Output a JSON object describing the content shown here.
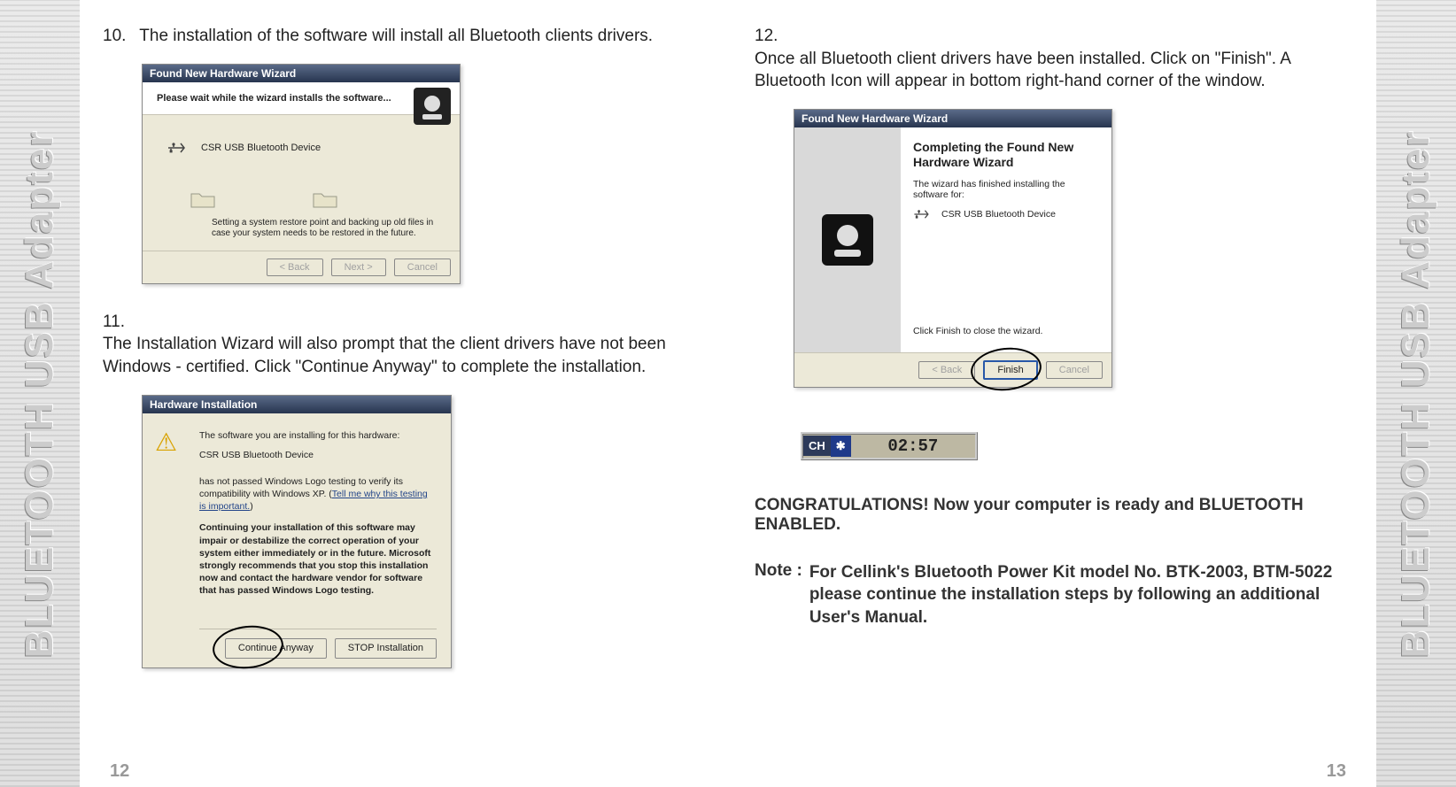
{
  "side_label": "BLUETOOTH USB Adapter",
  "left_page": {
    "number": "12",
    "step10": {
      "num": "10.",
      "text": "The installation of the software will install  all Bluetooth clients drivers."
    },
    "step11": {
      "num": "11.",
      "text": "The Installation Wizard will also prompt that  the client drivers have not been Windows - certified. Click \"Continue Anyway\" to complete the installation."
    },
    "installing_dialog": {
      "title": "Found New Hardware Wizard",
      "heading": "Please wait while the wizard installs the software...",
      "device": "CSR USB Bluetooth Device",
      "subtext": "Setting a system restore point and backing up old files in case your system needs to be restored in the future.",
      "back": "< Back",
      "next": "Next >",
      "cancel": "Cancel"
    },
    "hw_dialog": {
      "title": "Hardware Installation",
      "line1": "The software you are installing for this hardware:",
      "device": "CSR USB Bluetooth Device",
      "line2": "has not passed Windows Logo testing to verify its compatibility with Windows XP. (",
      "link": "Tell me why this testing is important.",
      "line2_end": ")",
      "bold": "Continuing your installation of this software may impair or destabilize the correct operation of your system either immediately or in the future. Microsoft strongly recommends that you stop this installation now and contact the hardware vendor for software that has passed Windows Logo testing.",
      "continue": "Continue Anyway",
      "stop": "STOP Installation"
    }
  },
  "right_page": {
    "number": "13",
    "step12": {
      "num": "12.",
      "text": "Once all Bluetooth client drivers have  been installed. Click on \"Finish\". A Bluetooth Icon will appear in bottom right-hand corner of the window."
    },
    "complete_dialog": {
      "title": "Found New Hardware Wizard",
      "heading": "Completing the Found New Hardware Wizard",
      "sub": "The wizard has finished installing the software for:",
      "device": "CSR USB Bluetooth Device",
      "closing": "Click Finish to close the wizard.",
      "back": "< Back",
      "finish": "Finish",
      "cancel": "Cancel"
    },
    "tray": {
      "lang": "CH",
      "bt_glyph": "✱",
      "clock": "02:57"
    },
    "congrats": "CONGRATULATIONS! Now your computer is ready and BLUETOOTH ENABLED.",
    "note_label": "Note :",
    "note_text": "For Cellink's Bluetooth Power Kit model No. BTK-2003, BTM-5022 please continue the installation steps by following an additional User's Manual."
  }
}
